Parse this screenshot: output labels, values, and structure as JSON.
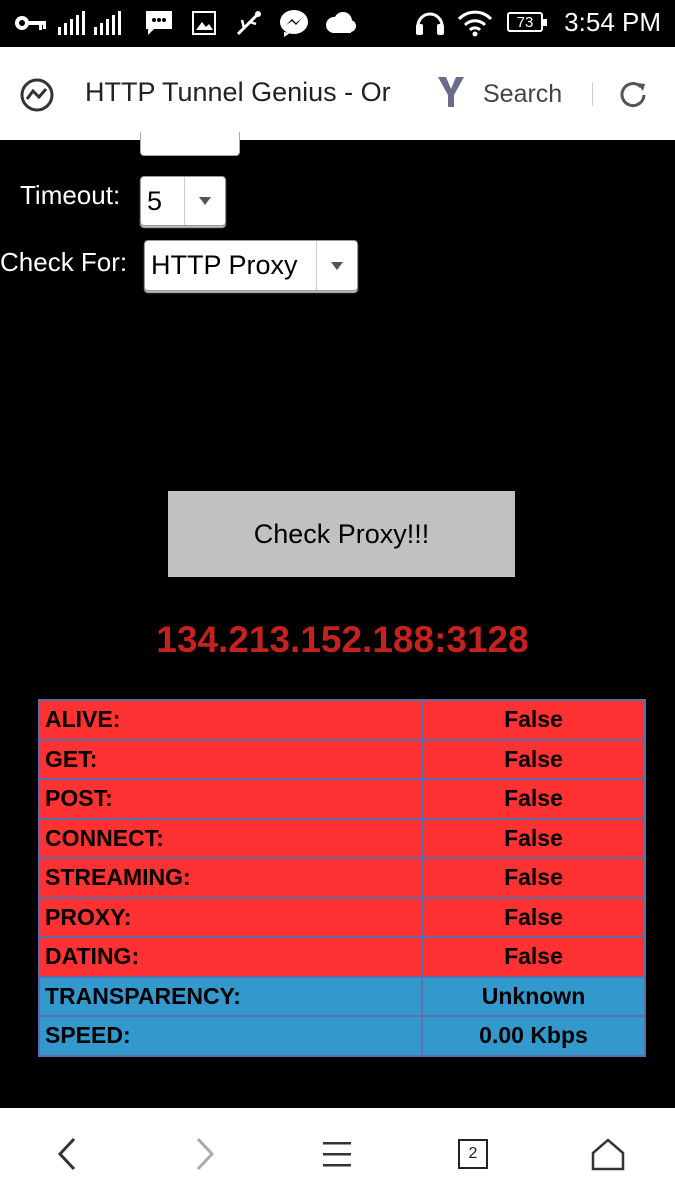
{
  "status_bar": {
    "time": "3:54 PM",
    "battery": "73",
    "icons": [
      "key-icon",
      "signal-icon",
      "signal-icon",
      "messages-icon",
      "gallery-icon",
      "usb-icon",
      "messenger-icon",
      "cloud-icon",
      "headset-icon",
      "wifi-icon",
      "battery-icon"
    ]
  },
  "browser": {
    "page_title": "HTTP Tunnel Genius - Or",
    "search_label": "Search"
  },
  "form": {
    "timeout_label": "Timeout:",
    "timeout_value": "5",
    "check_for_label": "Check For:",
    "check_for_value": "HTTP Proxy",
    "button_label": "Check Proxy!!!"
  },
  "result": {
    "proxy": "134.213.152.188:3128",
    "colors": {
      "fail": "#fe3232",
      "info": "#3399cc",
      "proxy_text": "#c42121"
    },
    "rows": [
      {
        "key": "ALIVE:",
        "value": "False",
        "status": "fail"
      },
      {
        "key": "GET:",
        "value": "False",
        "status": "fail"
      },
      {
        "key": "POST:",
        "value": "False",
        "status": "fail"
      },
      {
        "key": "CONNECT:",
        "value": "False",
        "status": "fail"
      },
      {
        "key": "STREAMING:",
        "value": "False",
        "status": "fail"
      },
      {
        "key": "PROXY:",
        "value": "False",
        "status": "fail"
      },
      {
        "key": "DATING:",
        "value": "False",
        "status": "fail"
      },
      {
        "key": "TRANSPARENCY:",
        "value": "Unknown",
        "status": "info"
      },
      {
        "key": "SPEED:",
        "value": "0.00 Kbps",
        "status": "info"
      }
    ]
  },
  "bottom_nav": {
    "tab_count": "2",
    "icons": [
      "back-icon",
      "forward-icon",
      "menu-icon",
      "tabs-icon",
      "home-icon"
    ]
  }
}
